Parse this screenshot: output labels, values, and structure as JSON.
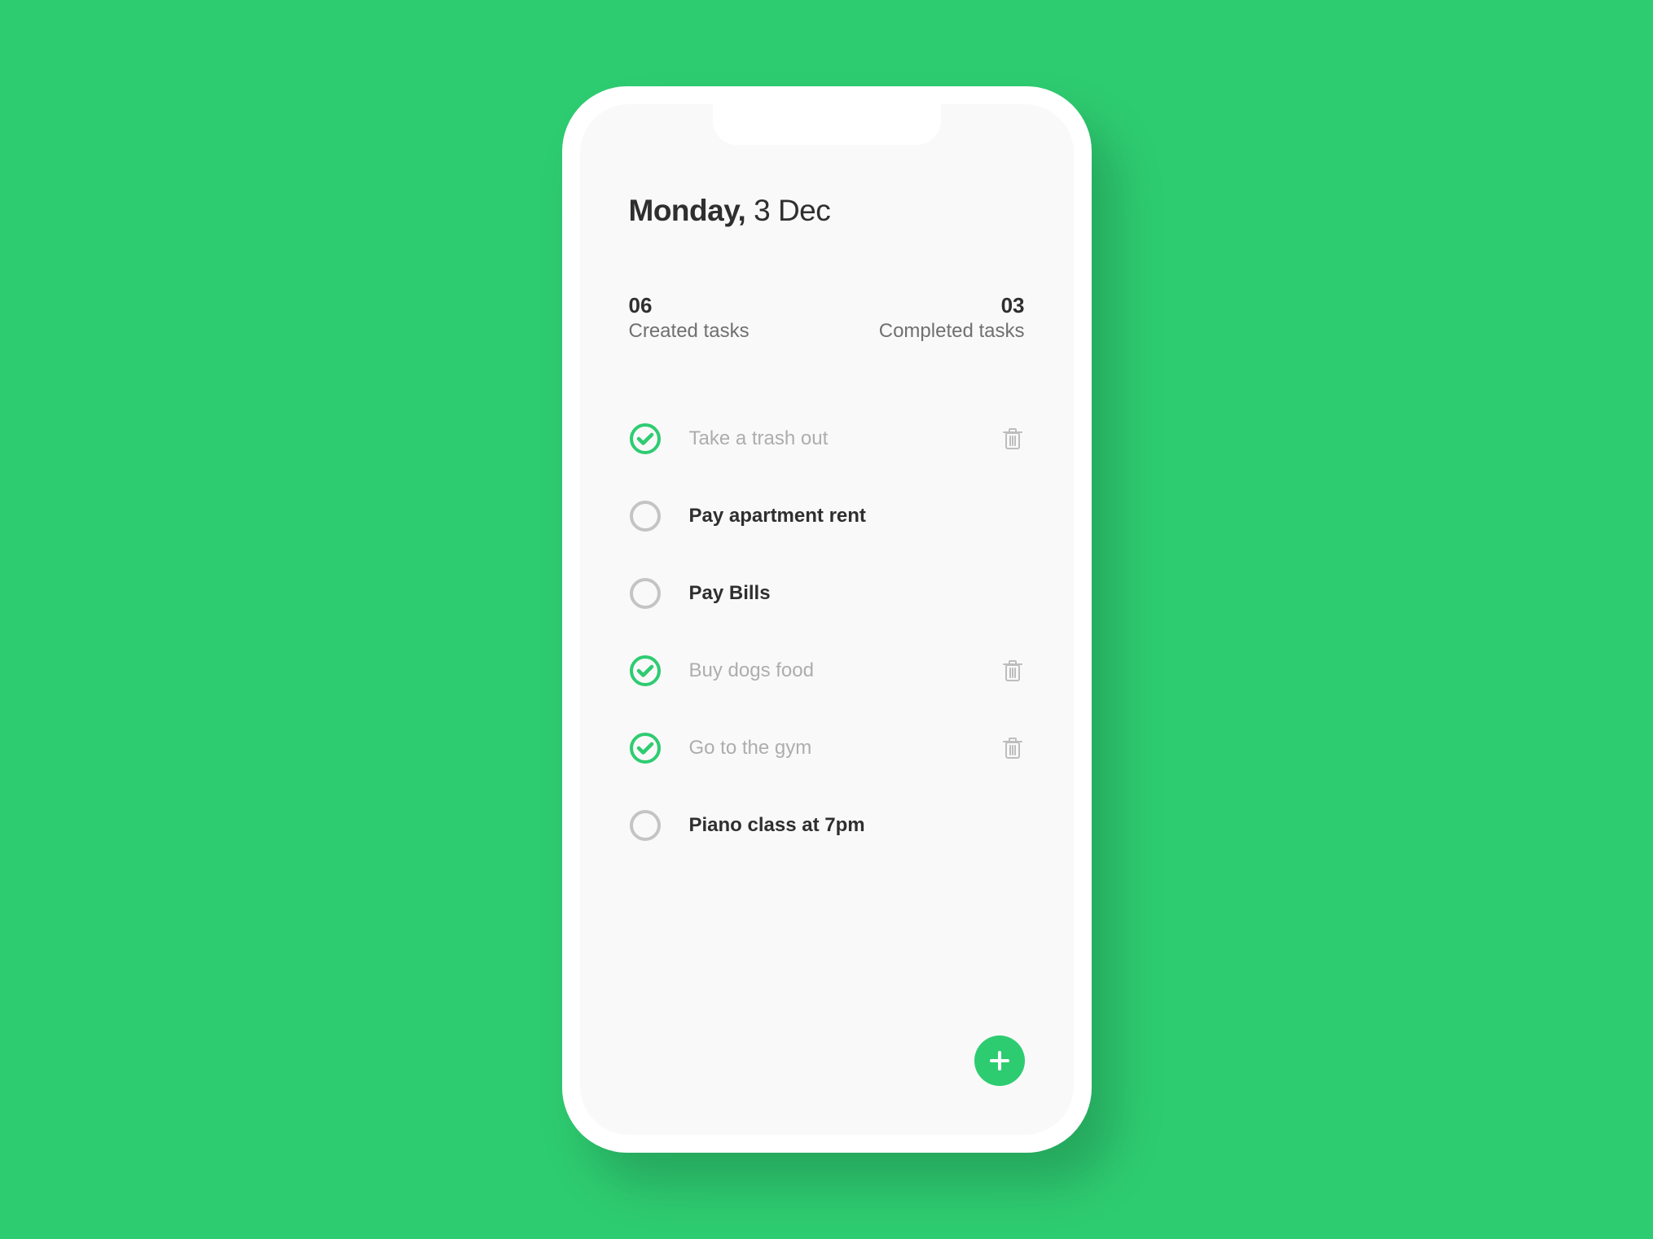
{
  "colors": {
    "accent": "#2ecc71",
    "text": "#2f2f2f",
    "muted": "#adadad",
    "label": "#707070",
    "circle": "#c4c4c4",
    "trash": "#bdbdbd"
  },
  "header": {
    "day": "Monday,",
    "date": " 3 Dec"
  },
  "stats": {
    "created": {
      "count": "06",
      "label": "Created tasks"
    },
    "completed": {
      "count": "03",
      "label": "Completed tasks"
    }
  },
  "tasks": [
    {
      "title": "Take a trash out",
      "done": true
    },
    {
      "title": "Pay apartment rent",
      "done": false
    },
    {
      "title": "Pay Bills",
      "done": false
    },
    {
      "title": "Buy dogs food",
      "done": true
    },
    {
      "title": "Go to the gym",
      "done": true
    },
    {
      "title": "Piano class at 7pm",
      "done": false
    }
  ],
  "fab": {
    "label": "Add task"
  }
}
